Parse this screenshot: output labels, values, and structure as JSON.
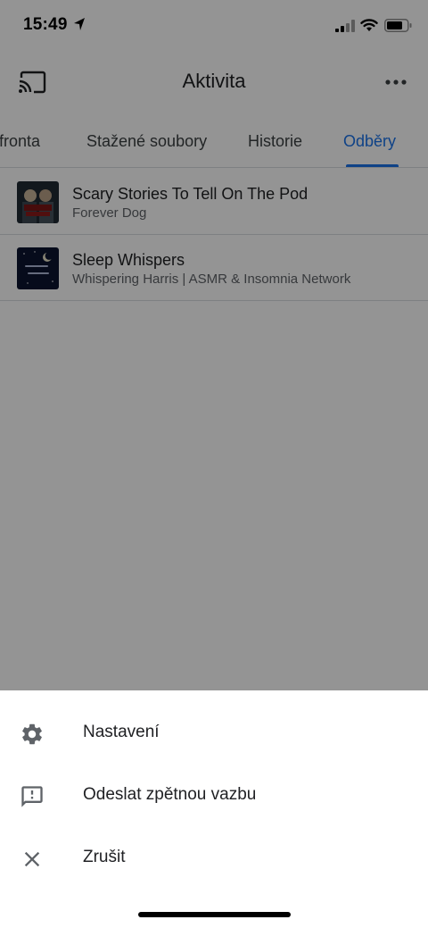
{
  "status_bar": {
    "time": "15:49",
    "location_icon": "location-arrow-icon",
    "signal_icon": "cellular-signal-icon",
    "wifi_icon": "wifi-icon",
    "battery_icon": "battery-icon"
  },
  "app_bar": {
    "title": "Aktivita",
    "cast_icon": "cast-icon",
    "more_icon": "more-horizontal-icon"
  },
  "tabs": [
    {
      "label": "fronta"
    },
    {
      "label": "Stažené soubory"
    },
    {
      "label": "Historie"
    },
    {
      "label": "Odběry"
    }
  ],
  "active_tab": "Odběry",
  "subscriptions": [
    {
      "title": "Scary Stories To Tell On The Pod",
      "author": "Forever Dog"
    },
    {
      "title": "Sleep Whispers",
      "author": "Whispering Harris | ASMR & Insomnia Network"
    }
  ],
  "sheet": {
    "items": [
      {
        "label": "Nastavení",
        "icon": "settings-gear-icon"
      },
      {
        "label": "Odeslat zpětnou vazbu",
        "icon": "feedback-icon"
      },
      {
        "label": "Zrušit",
        "icon": "close-icon"
      }
    ]
  },
  "colors": {
    "accent": "#1a73e8",
    "scrim": "#000000"
  }
}
